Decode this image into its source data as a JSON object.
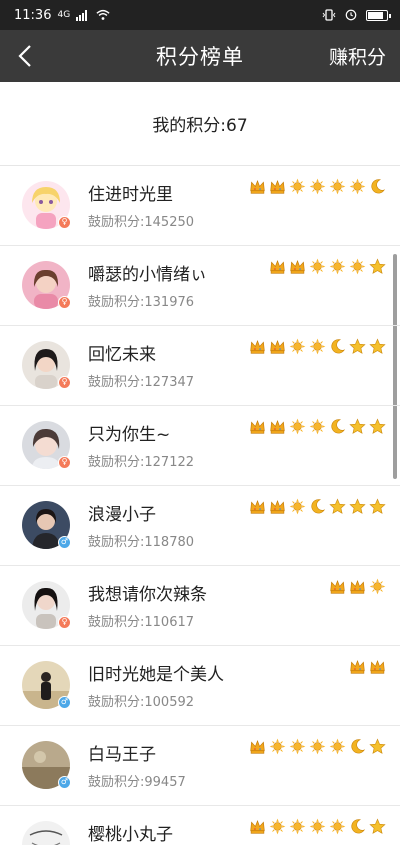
{
  "status": {
    "time": "11:36",
    "signal": "4G"
  },
  "nav": {
    "title": "积分榜单",
    "action": "赚积分"
  },
  "my_score": "我的积分:67",
  "colors": {
    "female_badge": "#f47b5a",
    "male_badge": "#4da8e8",
    "crown": "#f2a81d",
    "sun": "#f7b52c",
    "moon": "#f2b322",
    "star": "#f5c02c"
  },
  "users": [
    {
      "name": "住进时光里",
      "score": "鼓励积分:145250",
      "gender": "f",
      "levels": [
        "crown",
        "crown",
        "sun",
        "sun",
        "sun",
        "sun",
        "moon"
      ]
    },
    {
      "name": "嚼瑟的小情绪ぃ",
      "score": "鼓励积分:131976",
      "gender": "f",
      "levels": [
        "crown",
        "crown",
        "sun",
        "sun",
        "sun",
        "star"
      ]
    },
    {
      "name": "回忆未来",
      "score": "鼓励积分:127347",
      "gender": "f",
      "levels": [
        "crown",
        "crown",
        "sun",
        "sun",
        "moon",
        "star",
        "star"
      ]
    },
    {
      "name": "只为你生~",
      "score": "鼓励积分:127122",
      "gender": "f",
      "levels": [
        "crown",
        "crown",
        "sun",
        "sun",
        "moon",
        "star",
        "star"
      ]
    },
    {
      "name": "浪漫小子",
      "score": "鼓励积分:118780",
      "gender": "m",
      "levels": [
        "crown",
        "crown",
        "sun",
        "moon",
        "star",
        "star",
        "star"
      ]
    },
    {
      "name": "我想请你次辣条",
      "score": "鼓励积分:110617",
      "gender": "f",
      "levels": [
        "crown",
        "crown",
        "sun"
      ]
    },
    {
      "name": "旧时光她是个美人",
      "score": "鼓励积分:100592",
      "gender": "m",
      "levels": [
        "crown",
        "crown"
      ]
    },
    {
      "name": "白马王子",
      "score": "鼓励积分:99457",
      "gender": "m",
      "levels": [
        "crown",
        "sun",
        "sun",
        "sun",
        "sun",
        "moon",
        "star"
      ]
    },
    {
      "name": "樱桃小丸子",
      "score": "",
      "gender": "f",
      "levels": [
        "crown",
        "sun",
        "sun",
        "sun",
        "sun",
        "moon",
        "star"
      ]
    }
  ]
}
